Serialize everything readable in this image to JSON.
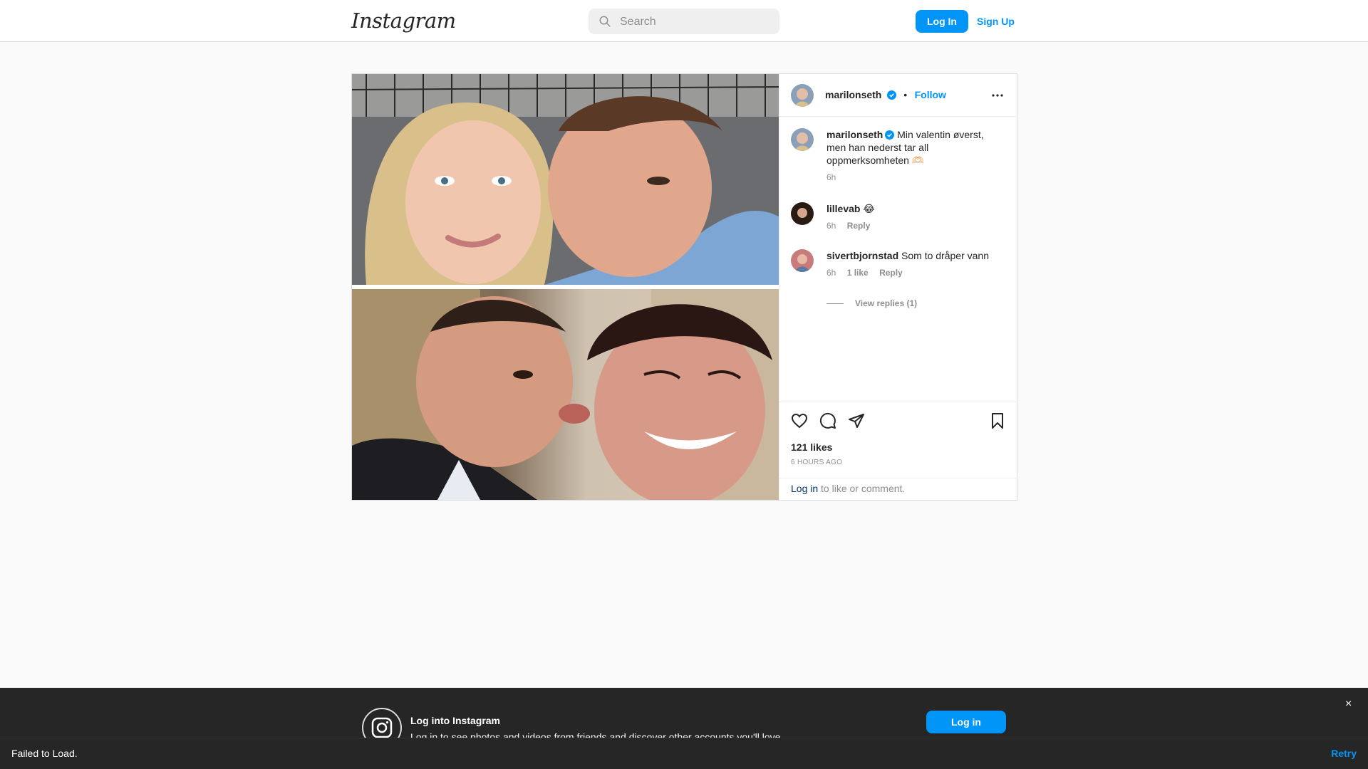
{
  "nav": {
    "logo": "Instagram",
    "search_placeholder": "Search",
    "login_label": "Log In",
    "signup_label": "Sign Up"
  },
  "post": {
    "author": "marilonseth",
    "follow_label": "Follow",
    "separator": "•",
    "caption": {
      "user": "marilonseth",
      "text": "Min valentin øverst, men han nederst tar all oppmerksomheten 🫶🏻",
      "time": "6h"
    },
    "comments": [
      {
        "user": "lillevab",
        "text": "😂",
        "time": "6h",
        "likes": "",
        "reply": "Reply"
      },
      {
        "user": "sivertbjornstad",
        "text": "Som to dråper vann",
        "time": "6h",
        "likes": "1 like",
        "reply": "Reply"
      }
    ],
    "view_replies": "View replies (1)",
    "likes": "121 likes",
    "posted_ago": "6 HOURS AGO",
    "login_link": "Log in",
    "login_text": " to like or comment."
  },
  "banner": {
    "title": "Log into Instagram",
    "subtitle": "Log in to see photos and videos from friends and discover other accounts you'll love.",
    "login_label": "Log in",
    "close": "×"
  },
  "toast": {
    "message": "Failed to Load.",
    "retry": "Retry"
  },
  "colors": {
    "accent": "#0095f6",
    "verified": "#0095f6",
    "banner_bg": "#262626"
  }
}
